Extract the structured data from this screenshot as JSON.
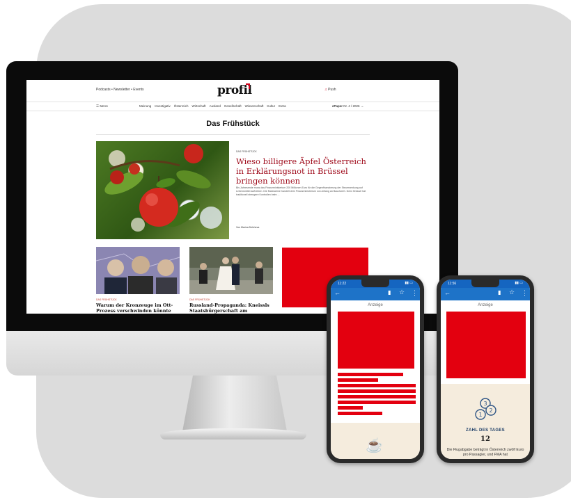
{
  "website": {
    "top_links": "Podcasts  •  Newsletter  •  Events",
    "logo": "profil",
    "push_label": "Push",
    "menu_label": "Menü",
    "nav_items": [
      "Meinung",
      "Investigativ",
      "Österreich",
      "Wirtschaft",
      "Ausland",
      "Gesellschaft",
      "Wissenschaft",
      "Kultur",
      "Extra"
    ],
    "epaper_prefix": "ePaper",
    "epaper_issue": "Nr. 4 / 2026",
    "section_title": "Das Frühstück",
    "hero": {
      "kicker": "DAS FRÜHSTÜCK",
      "headline": "Wieso billigere Äpfel Österreich in Erklärungsnot in Brüssel bringen können",
      "teaser": "Bis Jahresende muss das Finanzministerium 200 Millionen Euro für die Gegenfinanzierung der Steuersenkung auf Lebensmittel auftreiben. Die Maßnahme handelt dem Finanzministerium von Anfang an Bauchweh. Denn Brüssel hat traditionell strengere Kontrollen beim ...",
      "author": "Von Marina Delcheva"
    },
    "cards": [
      {
        "kicker": "DAS FRÜHSTÜCK",
        "title": "Warum der Kronzeuge im Ott-Prozess verschwinden könnte"
      },
      {
        "kicker": "DAS FRÜHSTÜCK",
        "title": "Russland-Propaganda: Kneissls Staatsbürgerschaft am Prüfstand"
      }
    ]
  },
  "phone_left": {
    "time": "11:22",
    "anzeige": "Anzeige"
  },
  "phone_right": {
    "time": "11:56",
    "anzeige": "Anzeige",
    "zahl_label": "ZAHL DES TAGES",
    "zahl_value": "12",
    "zahl_text": "Die Flugabgabe beträgt in Österreich zwölf Euro pro Passagier, und FMA hat"
  },
  "colors": {
    "brand_red": "#a00d1d",
    "ad_red": "#e3000f",
    "app_blue": "#1e73c8",
    "backdrop": "#dcdcdc"
  }
}
